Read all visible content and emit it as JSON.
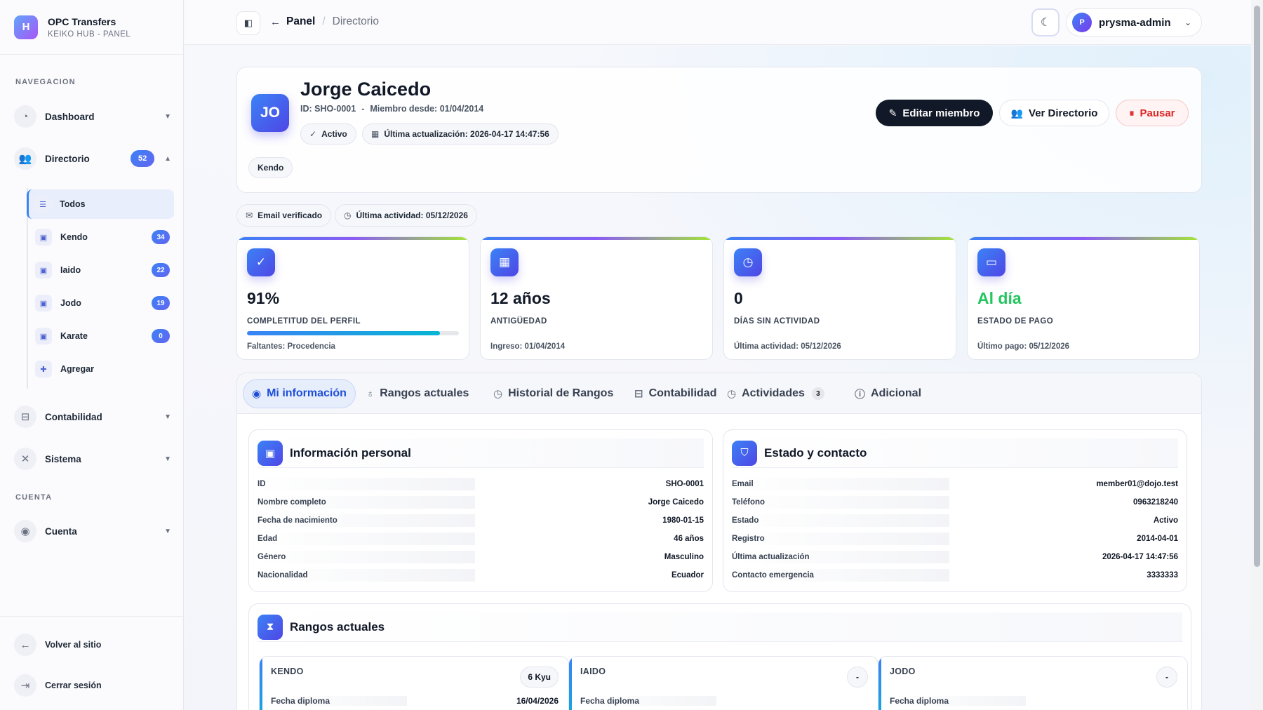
{
  "brand": {
    "logo": "H",
    "title": "OPC Transfers",
    "subtitle": "KEIKO HUB - PANEL"
  },
  "nav": {
    "section_nav": "NAVEGACION",
    "dashboard": "Dashboard",
    "directorio": "Directorio",
    "directorio_badge": "52",
    "sub": [
      {
        "label": "Todos",
        "badge": ""
      },
      {
        "label": "Kendo",
        "badge": "34"
      },
      {
        "label": "Iaido",
        "badge": "22"
      },
      {
        "label": "Jodo",
        "badge": "19"
      },
      {
        "label": "Karate",
        "badge": "0"
      },
      {
        "label": "Agregar",
        "badge": ""
      }
    ],
    "contabilidad": "Contabilidad",
    "sistema": "Sistema",
    "section_account": "CUENTA",
    "cuenta": "Cuenta",
    "volver": "Volver al sitio",
    "cerrar": "Cerrar sesión"
  },
  "topbar": {
    "crumb_1": "Panel",
    "crumb_2": "Directorio",
    "avatar": "P",
    "username": "prysma-admin"
  },
  "profile": {
    "initials": "JO",
    "name": "Jorge Caicedo",
    "id": "ID: SHO-0001",
    "member_since": "Miembro desde: 01/04/2014",
    "status": "Activo",
    "last_update": "Última actualización: 2026-04-17 14:47:56",
    "tag": "Kendo",
    "edit_label": "Editar miembro",
    "view_label": "Ver Directorio",
    "pause_label": "Pausar"
  },
  "chips": {
    "email": "Email verificado",
    "activity_label": "Última actividad:",
    "activity_date": "05/12/2026"
  },
  "stats": [
    {
      "value": "91%",
      "label": "COMPLETITUD DEL PERFIL",
      "note": "Faltantes: Procedencia",
      "progress": 0.91
    },
    {
      "value": "12 años",
      "label": "ANTIGÜEDAD",
      "note": "Ingreso: 01/04/2014"
    },
    {
      "value": "0",
      "label": "DÍAS SIN ACTIVIDAD",
      "note": "Última actividad: 05/12/2026"
    },
    {
      "value": "Al día",
      "label": "ESTADO DE PAGO",
      "note": "Último pago: 05/12/2026",
      "value_color": "#22c55e"
    }
  ],
  "tabs": [
    {
      "label": "Mi información"
    },
    {
      "label": "Rangos actuales"
    },
    {
      "label": "Historial de Rangos"
    },
    {
      "label": "Contabilidad"
    },
    {
      "label": "Actividades",
      "badge": "3"
    },
    {
      "label": "Adicional"
    }
  ],
  "personal": {
    "title": "Información personal",
    "rows": [
      {
        "k": "ID",
        "v": "SHO-0001"
      },
      {
        "k": "Nombre completo",
        "v": "Jorge Caicedo"
      },
      {
        "k": "Fecha de nacimiento",
        "v": "1980-01-15"
      },
      {
        "k": "Edad",
        "v": "46 años"
      },
      {
        "k": "Género",
        "v": "Masculino"
      },
      {
        "k": "Nacionalidad",
        "v": "Ecuador"
      }
    ]
  },
  "contact": {
    "title": "Estado y contacto",
    "rows": [
      {
        "k": "Email",
        "v": "member01@dojo.test"
      },
      {
        "k": "Teléfono",
        "v": "0963218240"
      },
      {
        "k": "Estado",
        "v": "Activo"
      },
      {
        "k": "Registro",
        "v": "2014-04-01"
      },
      {
        "k": "Última actualización",
        "v": "2026-04-17 14:47:56"
      },
      {
        "k": "Contacto emergencia",
        "v": "3333333"
      }
    ]
  },
  "ranks": {
    "title": "Rangos actuales",
    "items": [
      {
        "name": "KENDO",
        "badge": "6 Kyu",
        "k": "Fecha diploma",
        "v": "16/04/2026"
      },
      {
        "name": "IAIDO",
        "badge": "-",
        "k": "Fecha diploma",
        "v": ""
      },
      {
        "name": "JODO",
        "badge": "-",
        "k": "Fecha diploma",
        "v": ""
      }
    ]
  },
  "colors": {
    "accent": "#3b82f6",
    "dark": "#111827",
    "danger": "#dc2626",
    "success": "#22c55e"
  }
}
